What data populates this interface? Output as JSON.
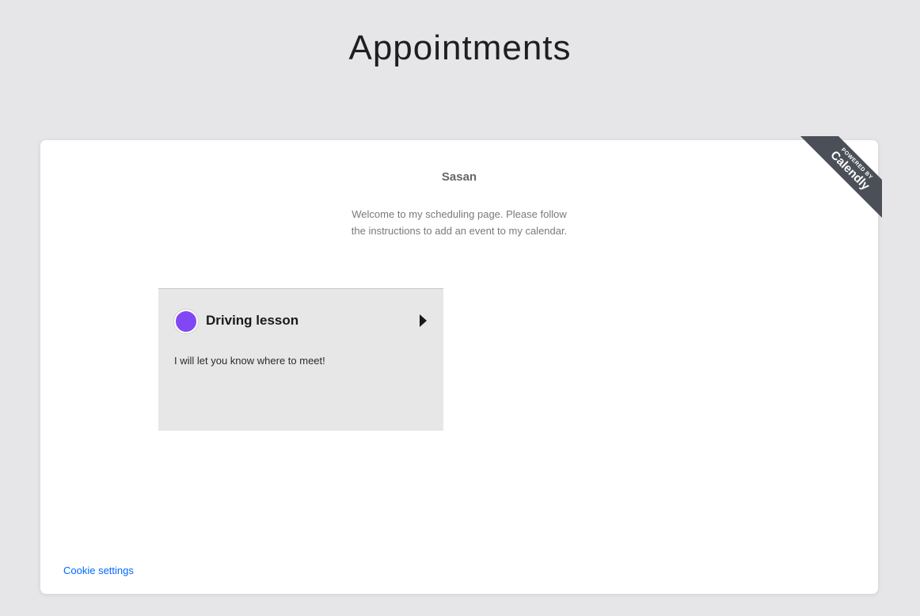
{
  "page": {
    "title": "Appointments"
  },
  "scheduler": {
    "owner_name": "Sasan",
    "welcome_message": "Welcome to my scheduling page. Please follow the instructions to add an event to my calendar.",
    "events": [
      {
        "name": "Driving lesson",
        "description": "I will let you know where to meet!",
        "color": "#8247f5",
        "icon": "chevron-right-icon"
      }
    ],
    "cookie_settings_label": "Cookie settings"
  },
  "badge": {
    "powered_by": "POWERED BY",
    "brand": "Calendly"
  },
  "colors": {
    "background": "#e6e6e8",
    "card": "#ffffff",
    "event_card": "#e7e7e7",
    "link": "#0069ff",
    "ribbon": "#4b5058"
  }
}
